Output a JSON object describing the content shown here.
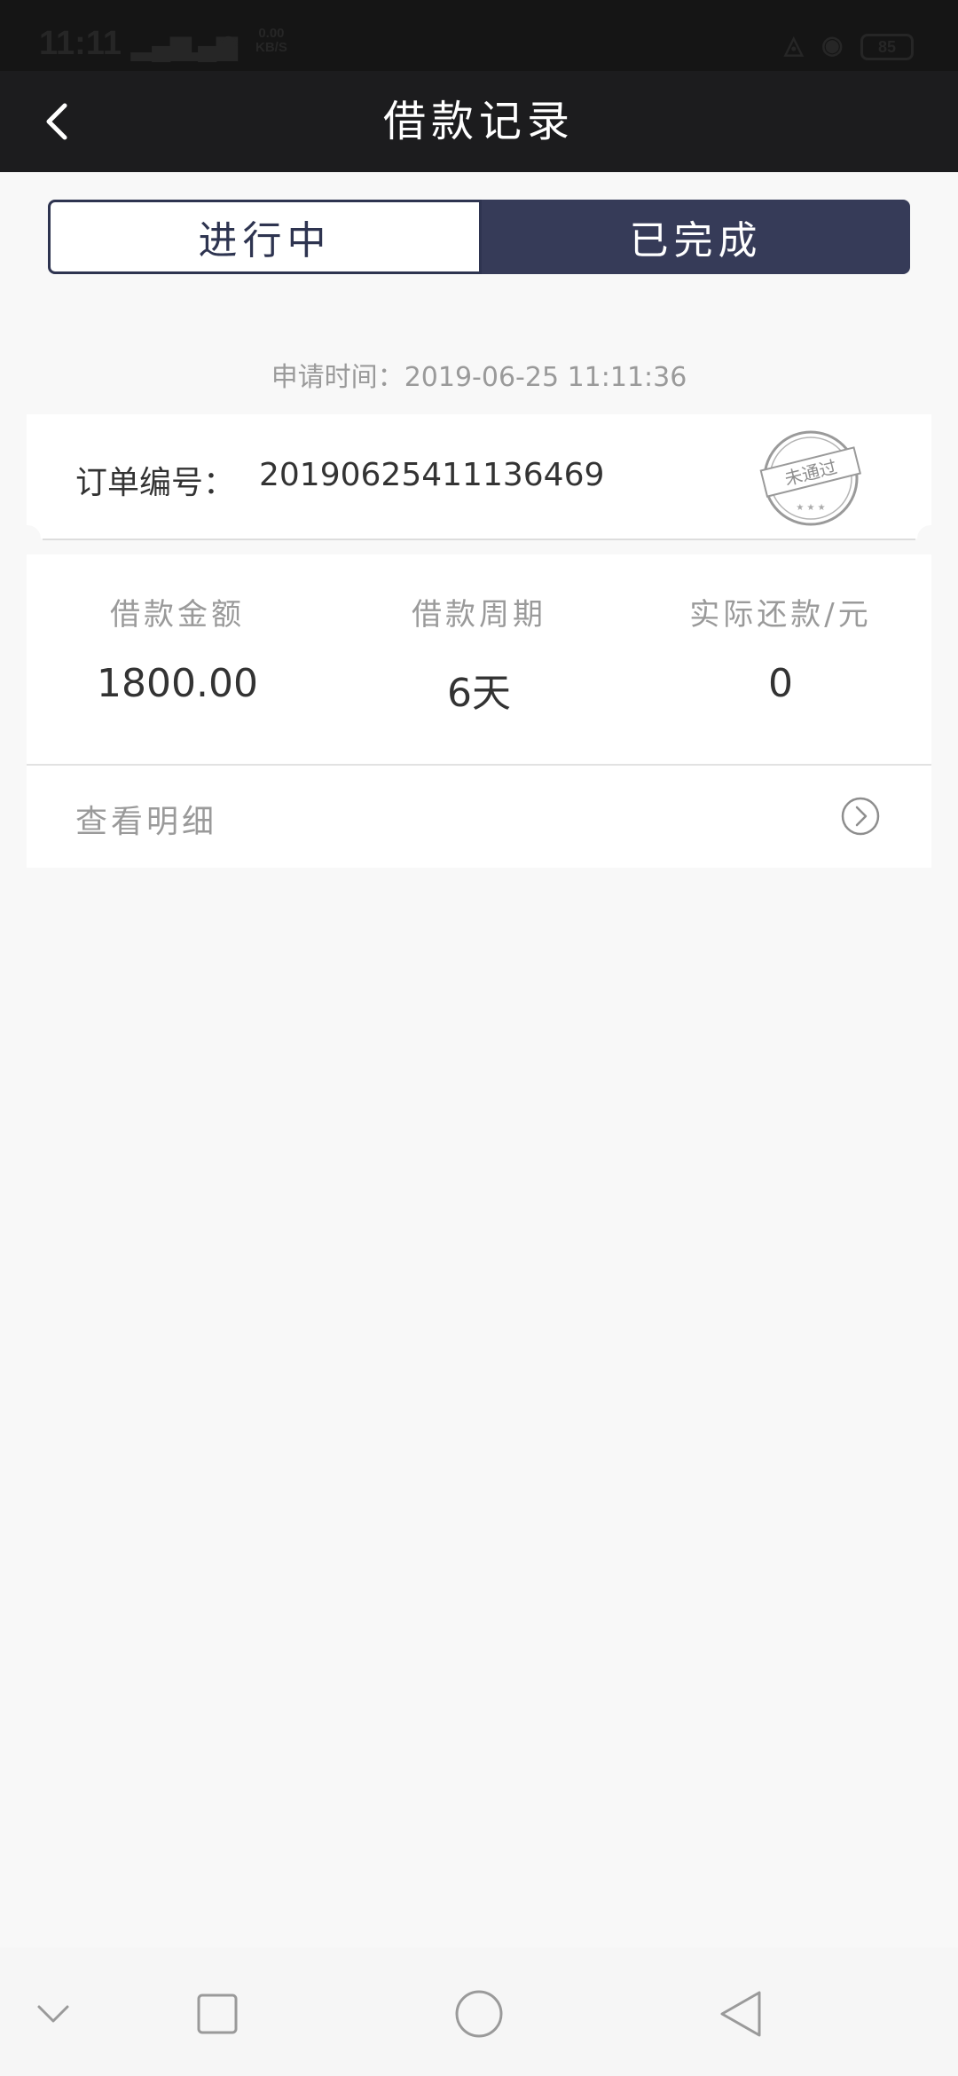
{
  "status_bar": {
    "time": "11:11",
    "net_speed": "0.00",
    "net_unit": "KB/S",
    "battery": "85"
  },
  "header": {
    "title": "借款记录",
    "back_icon": "chevron-left-icon"
  },
  "tabs": [
    {
      "label": "进行中",
      "active": false
    },
    {
      "label": "已完成",
      "active": true
    }
  ],
  "record": {
    "apply_time_label": "申请时间：",
    "apply_time": "2019-06-25 11:11:36",
    "order_label": "订单编号：",
    "order_number": "20190625411136469",
    "stamp_text": "未通过",
    "stats": [
      {
        "label": "借款金额",
        "value": "1800.00"
      },
      {
        "label": "借款周期",
        "value": "6天"
      },
      {
        "label": "实际还款/元",
        "value": "0"
      }
    ],
    "detail_label": "查看明细",
    "detail_icon": "circle-chevron-right-icon"
  },
  "colors": {
    "header_bg": "#1c1c1e",
    "tab_active_bg": "#363b58",
    "tab_border": "#2e3450",
    "page_bg": "#f8f8f8"
  },
  "system_nav": [
    "chevron-down-icon",
    "square-icon",
    "circle-icon",
    "triangle-back-icon"
  ]
}
